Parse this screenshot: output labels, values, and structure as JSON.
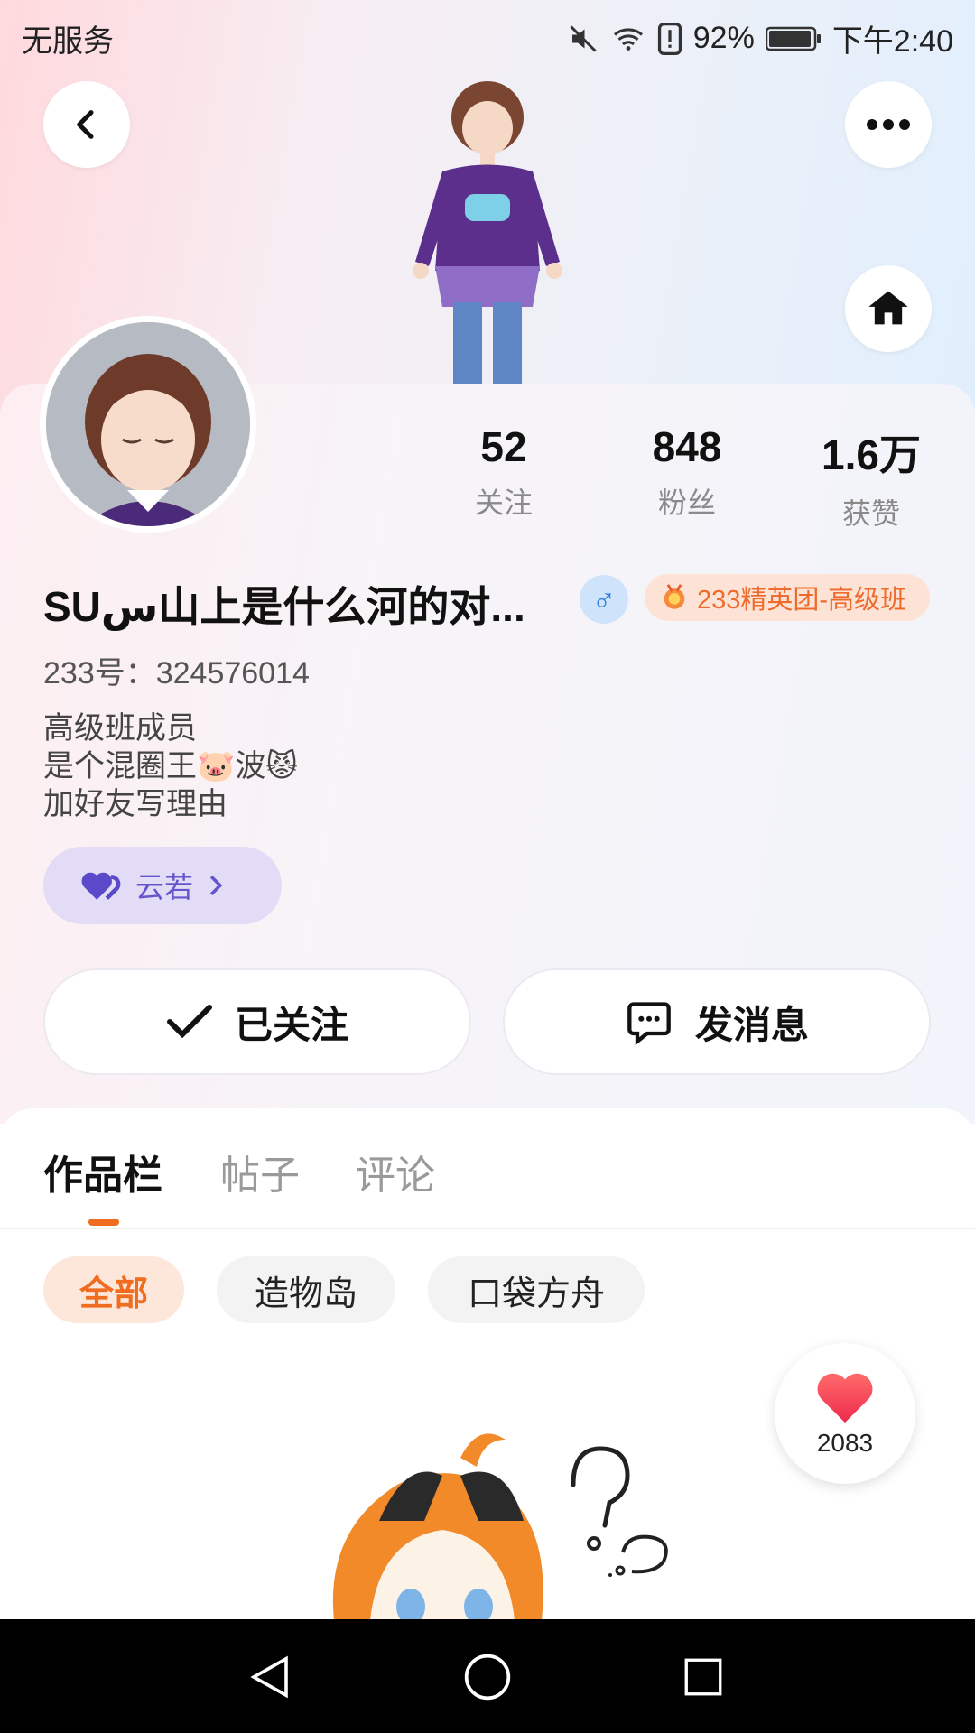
{
  "status": {
    "carrier": "无服务",
    "battery": "92%",
    "time": "下午2:40"
  },
  "header": {
    "back_icon": "chevron-left-icon",
    "more_icon": "more-dots-icon",
    "home_icon": "home-icon"
  },
  "profile": {
    "stats": [
      {
        "value": "52",
        "label": "关注"
      },
      {
        "value": "848",
        "label": "粉丝"
      },
      {
        "value": "1.6万",
        "label": "获赞"
      }
    ],
    "name": "SUس山上是什么河的对...",
    "gender_symbol": "♂",
    "badge": "233精英团-高级班",
    "uid": "233号：324576014",
    "bio": [
      "高级班成员",
      "是个混圈王🐷波😾",
      "加好友写理由"
    ],
    "relation_chip": "云若"
  },
  "actions": {
    "follow": "已关注",
    "message": "发消息"
  },
  "tabs": [
    {
      "label": "作品栏",
      "active": true
    },
    {
      "label": "帖子",
      "active": false
    },
    {
      "label": "评论",
      "active": false
    }
  ],
  "filters": [
    {
      "label": "全部",
      "active": true
    },
    {
      "label": "造物岛",
      "active": false
    },
    {
      "label": "口袋方舟",
      "active": false
    }
  ],
  "like_float": {
    "count": "2083"
  },
  "colors": {
    "accent": "#f06d1f",
    "chip": "#6654cc"
  }
}
